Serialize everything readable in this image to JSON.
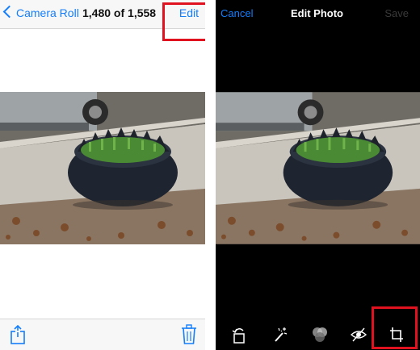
{
  "left": {
    "nav": {
      "back_label": "Camera Roll",
      "counter": "1,480 of 1,558",
      "edit_label": "Edit"
    },
    "toolbar": {
      "share_icon": "share-icon",
      "trash_icon": "trash-icon"
    }
  },
  "right": {
    "nav": {
      "cancel_label": "Cancel",
      "title": "Edit Photo",
      "save_label": "Save"
    },
    "toolbar": {
      "icons": [
        "rotate-icon",
        "enhance-wand-icon",
        "filters-icon",
        "red-eye-icon",
        "crop-icon"
      ]
    }
  },
  "colors": {
    "accent": "#147efb",
    "highlight": "#e0121f",
    "dark_bg": "#000000",
    "bar_bg": "#f7f7f7"
  }
}
